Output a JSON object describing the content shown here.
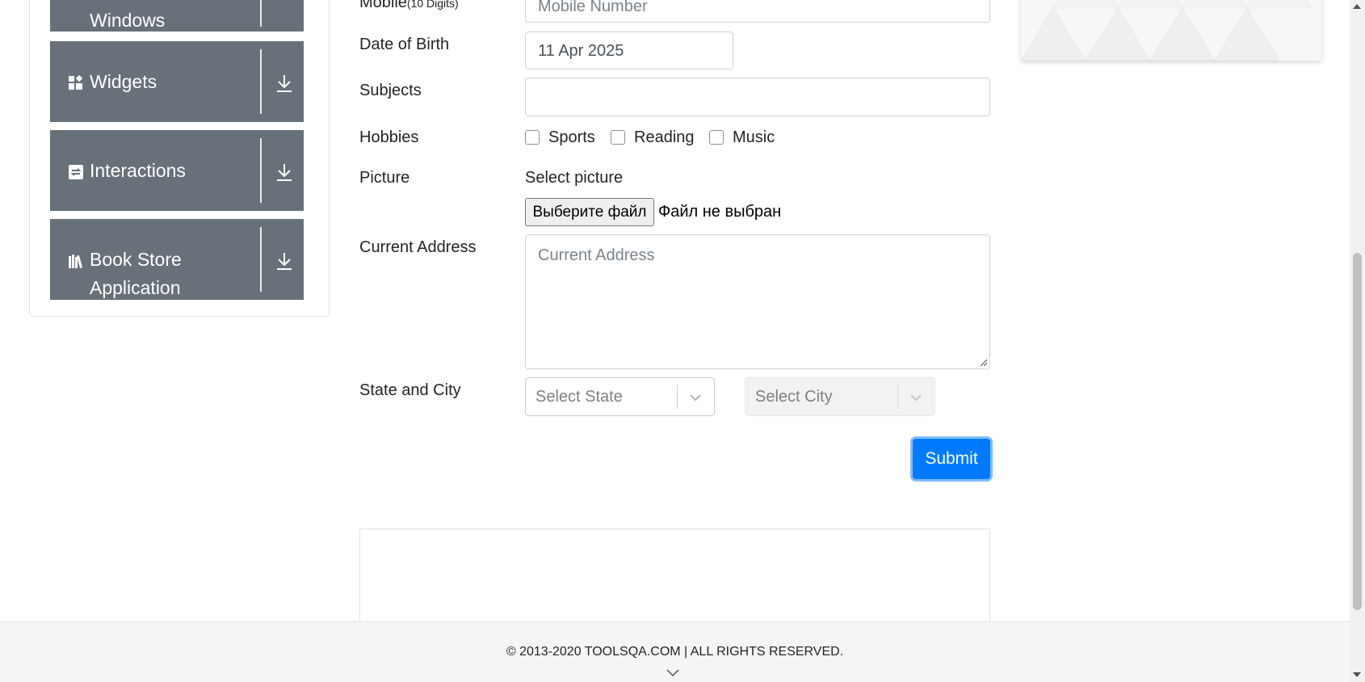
{
  "sidebar": {
    "items": [
      {
        "label": "Windows",
        "icon": "window-icon"
      },
      {
        "label": "Widgets",
        "icon": "widgets-icon"
      },
      {
        "label": "Interactions",
        "icon": "interactions-icon"
      },
      {
        "label_line1": "Book Store",
        "label_line2": "Application",
        "icon": "books-icon"
      }
    ],
    "group_bg_color": "#687079"
  },
  "form": {
    "mobile": {
      "label": "Mobile",
      "label_note": "(10 Digits)",
      "placeholder": "Mobile Number"
    },
    "dob": {
      "label": "Date of Birth",
      "value": "11 Apr 2025"
    },
    "subjects": {
      "label": "Subjects",
      "value": ""
    },
    "hobbies": {
      "label": "Hobbies",
      "options": [
        {
          "label": "Sports",
          "checked": false
        },
        {
          "label": "Reading",
          "checked": false
        },
        {
          "label": "Music",
          "checked": false
        }
      ]
    },
    "picture": {
      "label": "Picture",
      "title": "Select picture",
      "button_label": "Выберите файл",
      "status": "Файл не выбран"
    },
    "current_address": {
      "label": "Current Address",
      "placeholder": "Current Address"
    },
    "state_city": {
      "label": "State and City",
      "state_placeholder": "Select State",
      "city_placeholder": "Select City"
    },
    "submit_label": "Submit"
  },
  "footer": {
    "copyright": "© 2013-2020 TOOLSQA.COM | ALL RIGHTS RESERVED."
  },
  "colors": {
    "accent": "#007bff",
    "footer_bg": "#f5f5f5"
  }
}
